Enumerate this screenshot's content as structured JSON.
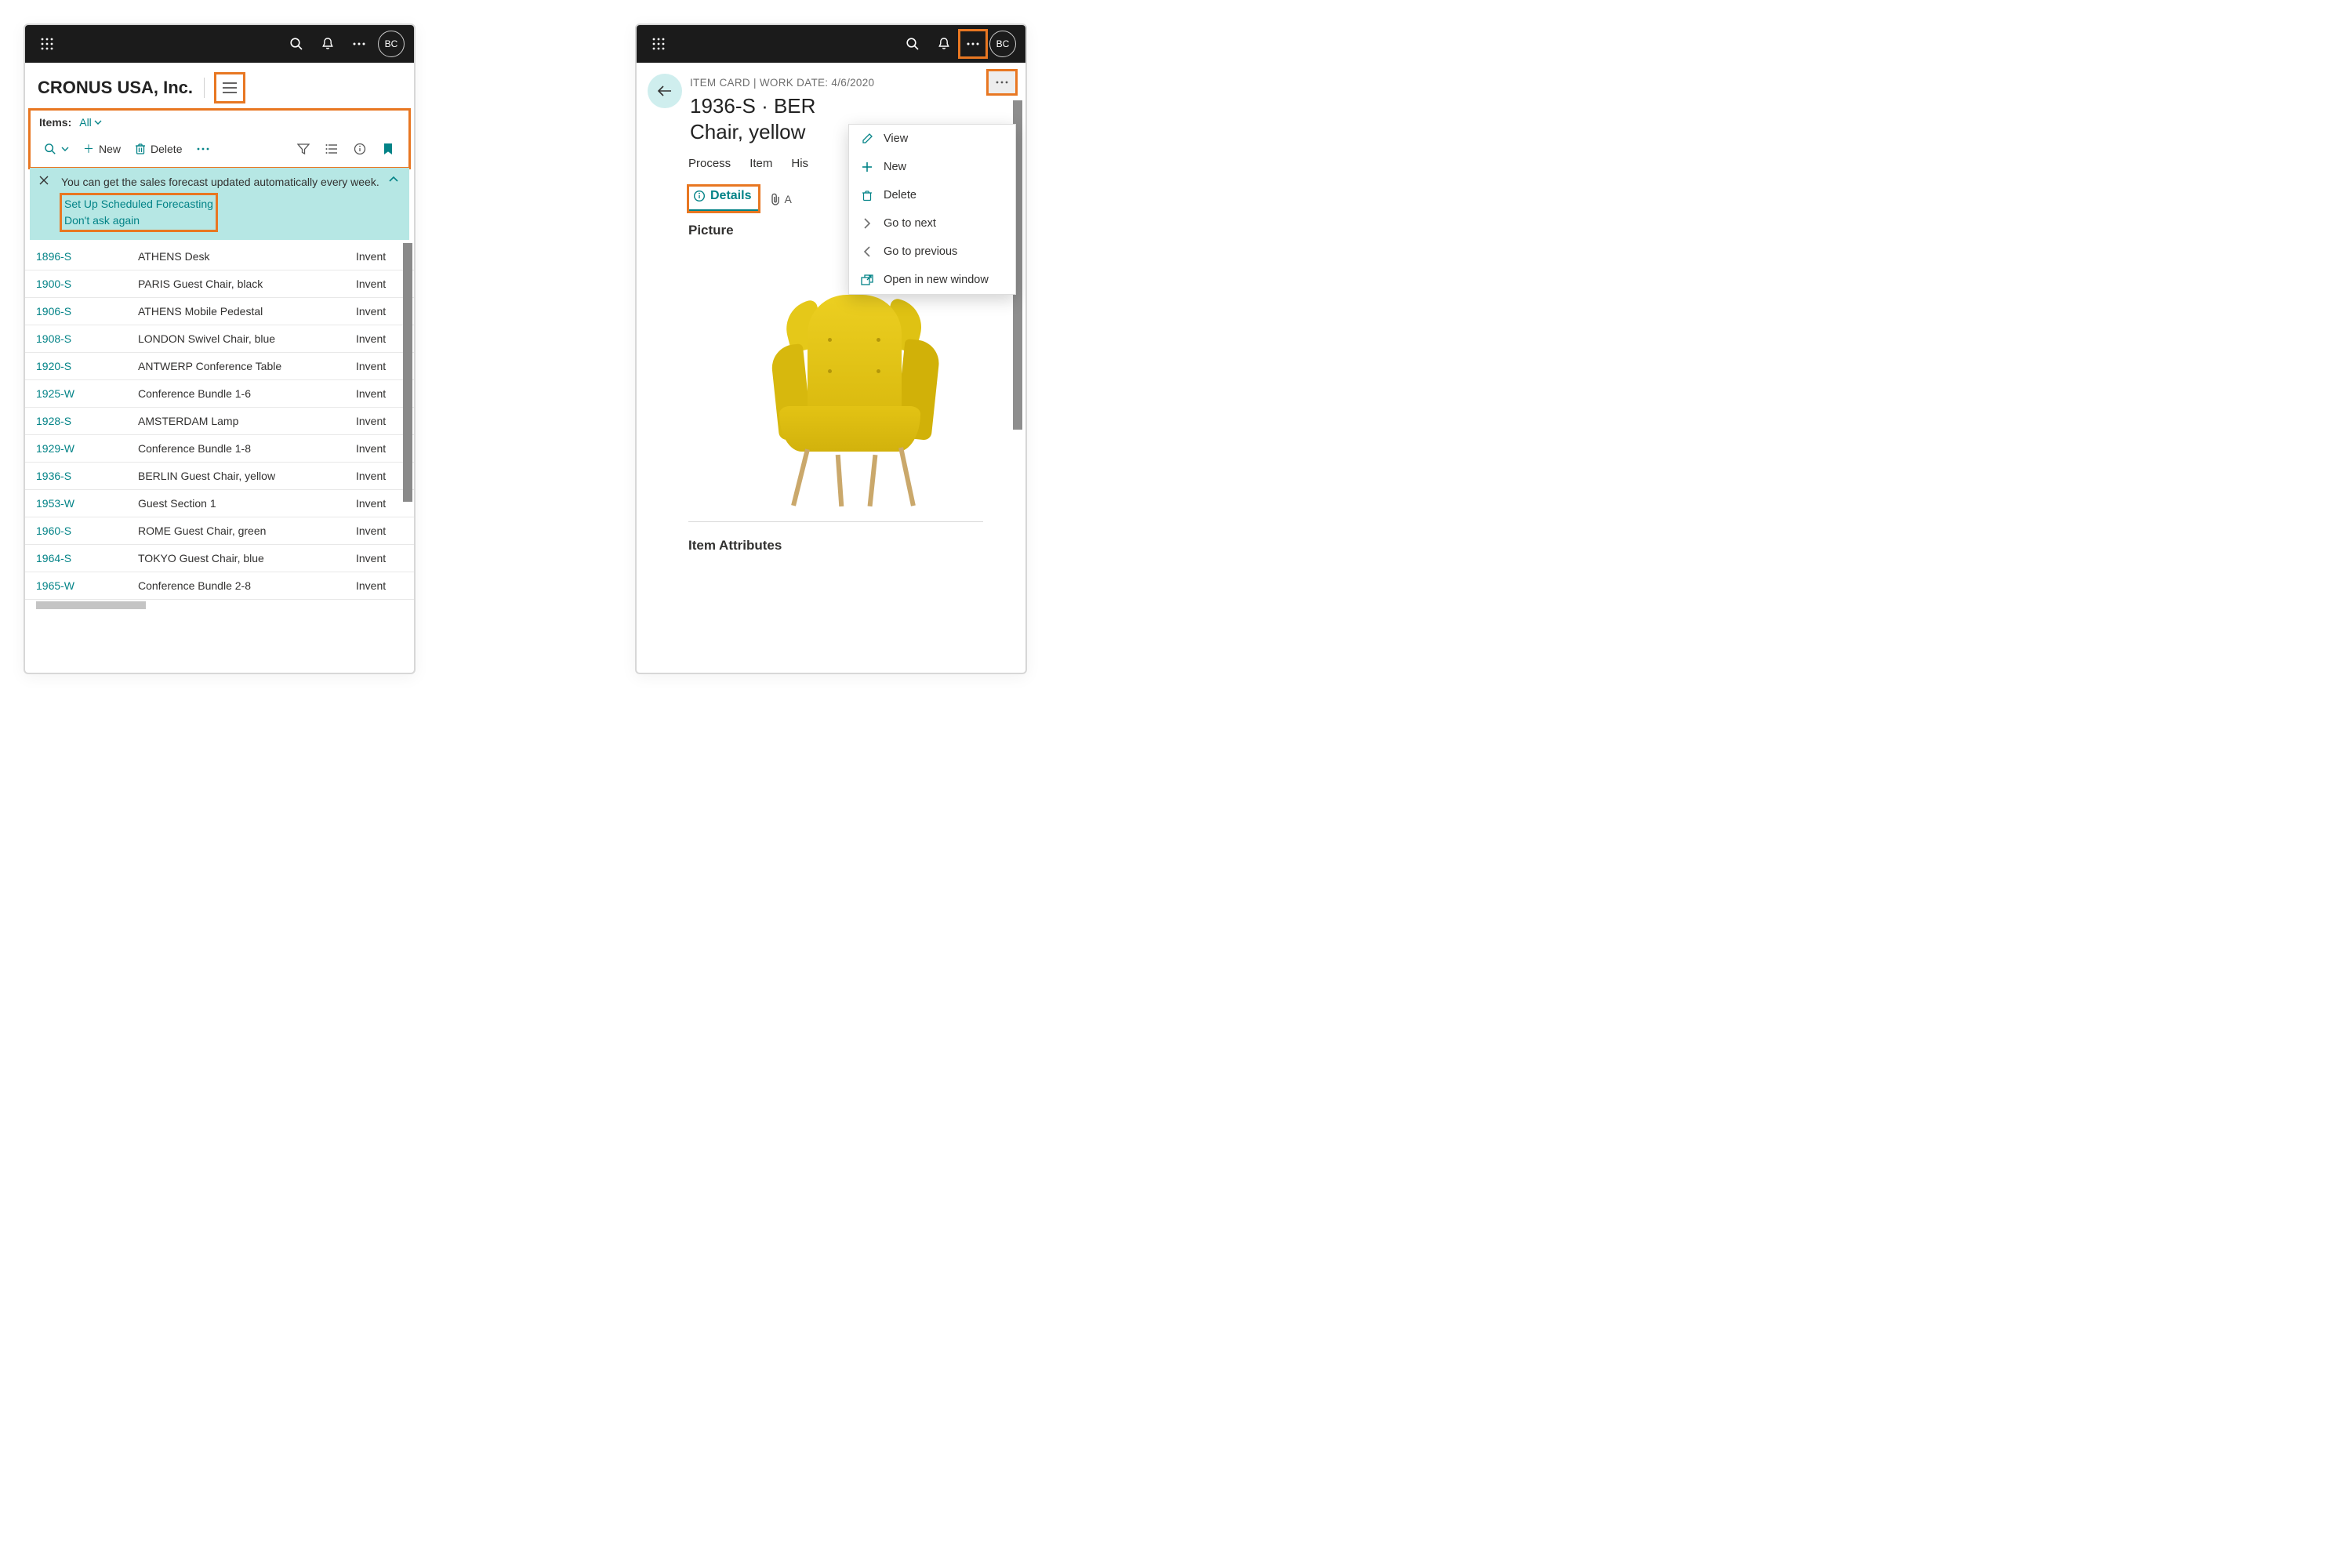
{
  "left": {
    "avatar": "BC",
    "company": "CRONUS USA, Inc.",
    "items_label": "Items:",
    "items_filter": "All",
    "action_new": "New",
    "action_delete": "Delete",
    "notif_text": "You can get the sales forecast updated automatically every week.",
    "notif_link1": "Set Up Scheduled Forecasting",
    "notif_link2": "Don't ask again",
    "col_inv": "Invent",
    "rows": [
      {
        "no": "1896-S",
        "desc": "ATHENS Desk"
      },
      {
        "no": "1900-S",
        "desc": "PARIS Guest Chair, black"
      },
      {
        "no": "1906-S",
        "desc": "ATHENS Mobile Pedestal"
      },
      {
        "no": "1908-S",
        "desc": "LONDON Swivel Chair, blue"
      },
      {
        "no": "1920-S",
        "desc": "ANTWERP Conference Table"
      },
      {
        "no": "1925-W",
        "desc": "Conference Bundle 1-6"
      },
      {
        "no": "1928-S",
        "desc": "AMSTERDAM Lamp"
      },
      {
        "no": "1929-W",
        "desc": "Conference Bundle 1-8"
      },
      {
        "no": "1936-S",
        "desc": "BERLIN Guest Chair, yellow"
      },
      {
        "no": "1953-W",
        "desc": "Guest Section 1"
      },
      {
        "no": "1960-S",
        "desc": "ROME Guest Chair, green"
      },
      {
        "no": "1964-S",
        "desc": "TOKYO Guest Chair, blue"
      },
      {
        "no": "1965-W",
        "desc": "Conference Bundle 2-8"
      }
    ]
  },
  "right": {
    "avatar": "BC",
    "breadcrumb": "ITEM CARD | WORK DATE: 4/6/2020",
    "title_line1": "1936-S · BER",
    "title_line2": "Chair, yellow",
    "tabs": {
      "process": "Process",
      "item": "Item",
      "history": "His"
    },
    "details": "Details",
    "attach": "A",
    "section_picture": "Picture",
    "section_attrs": "Item Attributes",
    "menu": {
      "view": "View",
      "new": "New",
      "delete": "Delete",
      "next": "Go to next",
      "prev": "Go to previous",
      "open": "Open in new window"
    }
  }
}
